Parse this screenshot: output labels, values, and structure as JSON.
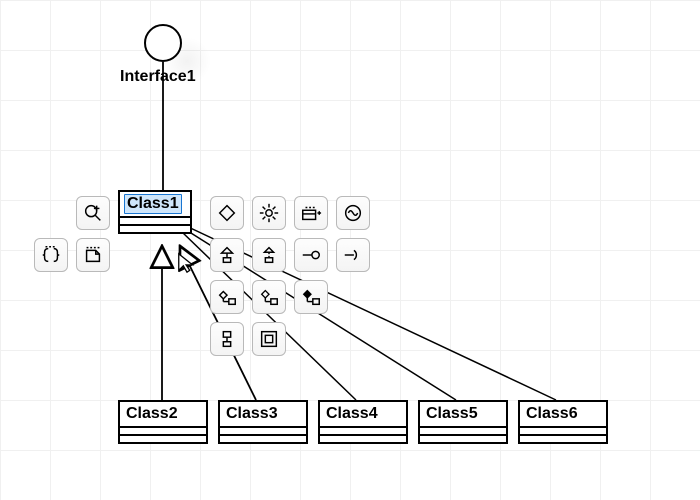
{
  "interface": {
    "name": "Interface1"
  },
  "classes": {
    "class1": "Class1",
    "class2": "Class2",
    "class3": "Class3",
    "class4": "Class4",
    "class5": "Class5",
    "class6": "Class6"
  },
  "tools": {
    "create_new_shape": "create-new-shape",
    "create_inner_class": "create-inner-class",
    "create_note": "create-note",
    "abstract": "abstract",
    "settings": "settings",
    "add_attribute": "add-attribute",
    "add_operation": "add-operation",
    "generalization": "generalization",
    "realization": "realization",
    "interface_usage": "interface-usage",
    "interface_provision": "interface-provision",
    "composition": "composition",
    "aggregation": "aggregation",
    "association": "association",
    "template_binding": "template-binding",
    "nested_class": "nested-class"
  }
}
